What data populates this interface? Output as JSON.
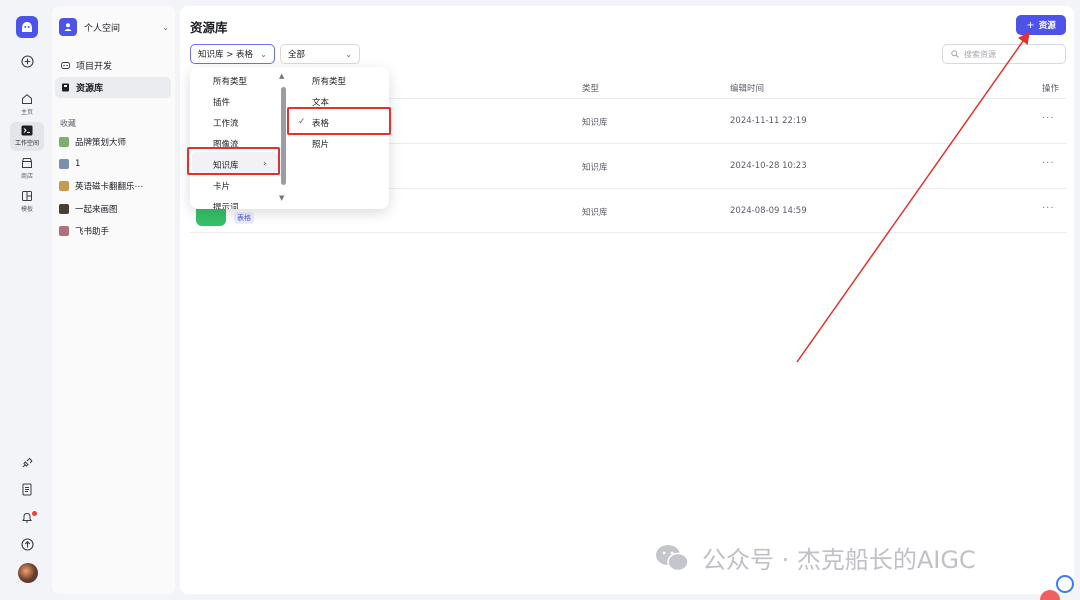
{
  "rail": {
    "items": [
      {
        "label": "主页",
        "icon": "home-icon"
      },
      {
        "label": "工作空间",
        "icon": "terminal-icon"
      },
      {
        "label": "商店",
        "icon": "store-icon"
      },
      {
        "label": "模板",
        "icon": "template-icon"
      }
    ]
  },
  "sidebar": {
    "space_name": "个人空间",
    "nav": [
      {
        "label": "项目开发",
        "icon": "project-icon"
      },
      {
        "label": "资源库",
        "icon": "library-icon"
      }
    ],
    "favorites_label": "收藏",
    "favorites": [
      {
        "label": "品牌策划大师",
        "color": "#7ab06a"
      },
      {
        "label": "1",
        "color": "#7c8fae"
      },
      {
        "label": "英语磁卡翻翻乐⋯",
        "color": "#c79a50"
      },
      {
        "label": "一起来画图",
        "color": "#4a4030"
      },
      {
        "label": "飞书助手",
        "color": "#b07080"
      }
    ]
  },
  "main": {
    "title": "资源库",
    "add_button": "资源",
    "filter_type": "知识库 > 表格",
    "filter_status": "全部",
    "search_placeholder": "搜索资源",
    "columns": {
      "type": "类型",
      "edit_time": "编辑时间",
      "actions": "操作"
    },
    "rows": [
      {
        "type": "知识库",
        "edit_time": "2024-11-11 22:19",
        "more": "···"
      },
      {
        "type": "知识库",
        "edit_time": "2024-10-28 10:23",
        "more": "···"
      },
      {
        "type": "知识库",
        "edit_time": "2024-08-09 14:59",
        "more": "···",
        "tag": "表格"
      }
    ]
  },
  "dropdown": {
    "primary": [
      "所有类型",
      "插件",
      "工作流",
      "图像流",
      "知识库",
      "卡片",
      "提示词"
    ],
    "secondary": [
      "所有类型",
      "文本",
      "表格",
      "照片"
    ],
    "selected_primary": "知识库",
    "selected_secondary": "表格"
  },
  "watermark": {
    "text": "公众号 · 杰克船长的AIGC"
  },
  "colors": {
    "accent": "#4d53e8",
    "highlight": "#e4312b"
  }
}
